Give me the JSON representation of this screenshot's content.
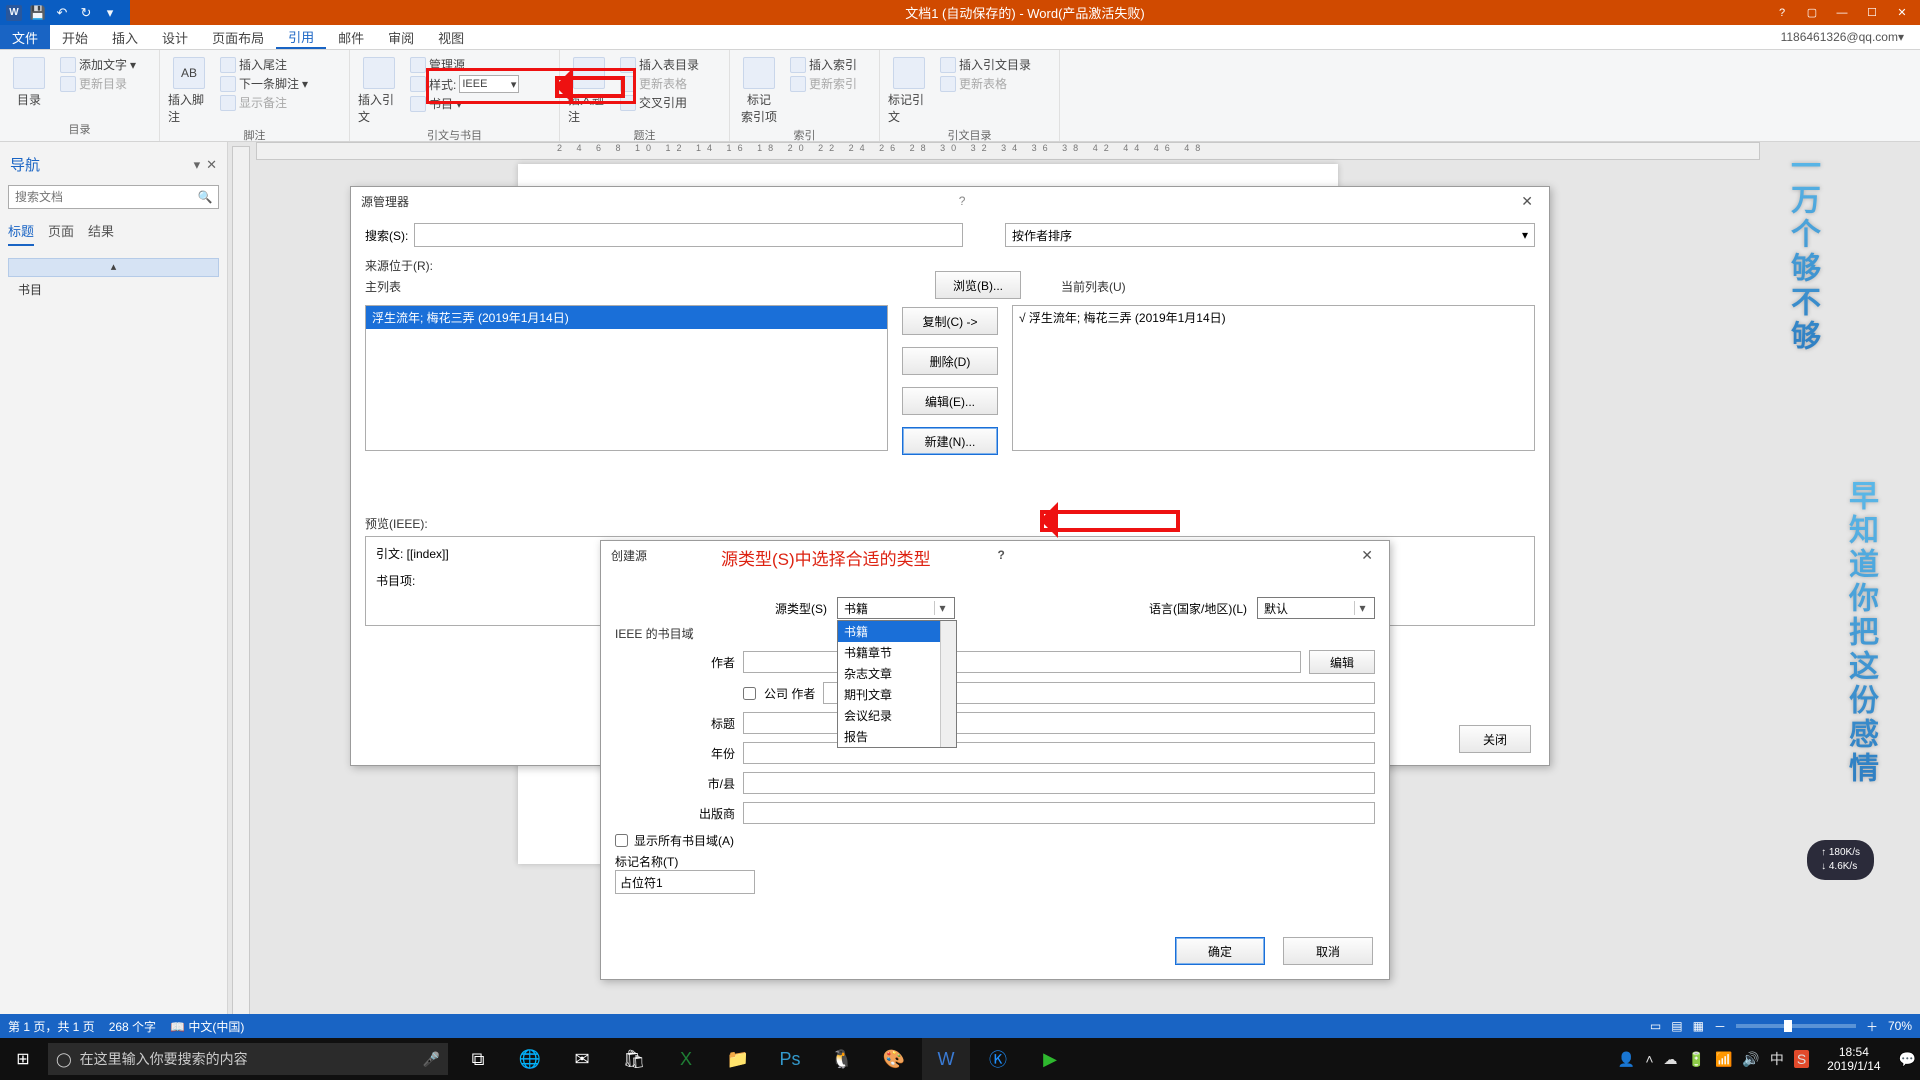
{
  "titlebar": {
    "title": "文档1 (自动保存的) - Word(产品激活失败)"
  },
  "account": "1186461326@qq.com",
  "ribbon_tabs": {
    "file": "文件",
    "home": "开始",
    "insert": "插入",
    "design": "设计",
    "layout": "页面布局",
    "references": "引用",
    "mailings": "邮件",
    "review": "审阅",
    "view": "视图"
  },
  "ribbon": {
    "toc": {
      "big": "目录",
      "add_text": "添加文字",
      "update": "更新目录",
      "group": "目录"
    },
    "footnotes": {
      "big_l1": "插入脚注",
      "ab": "AB",
      "next": "下一条脚注",
      "insert_end": "插入尾注",
      "show": "显示备注",
      "group": "脚注"
    },
    "citations": {
      "big_l1": "插入引文",
      "manage": "管理源",
      "style": "样式:",
      "style_val": "IEEE",
      "biblio": "书目",
      "group": "引文与书目"
    },
    "captions": {
      "big": "插入题注",
      "insert_tof": "插入表目录",
      "update_tof": "更新表格",
      "cross": "交叉引用",
      "group": "题注"
    },
    "index": {
      "big_l1": "标记",
      "big_l2": "索引项",
      "insert": "插入索引",
      "update": "更新索引",
      "group": "索引"
    },
    "toa": {
      "big": "标记引文",
      "insert": "插入引文目录",
      "update": "更新表格",
      "group": "引文目录"
    }
  },
  "nav": {
    "title": "导航",
    "search_ph": "搜索文档",
    "tabs": {
      "headings": "标题",
      "pages": "页面",
      "results": "结果"
    },
    "tree_item": "书目"
  },
  "ruler": "2  4  6  8  10  12  14  16  18  20  22  24  26  28  30  32  34  36  38        42  44  46  48",
  "wm1": "一万个够不够",
  "wm2": "早知道你把这份感情",
  "net": {
    "up": "↑ 180K/s",
    "down": "↓ 4.6K/s"
  },
  "srcmgr": {
    "title": "源管理器",
    "search": "搜索(S):",
    "sort": "按作者排序",
    "from": "来源位于(R):",
    "master": "主列表",
    "browse": "浏览(B)...",
    "current": "当前列表(U)",
    "copy": "复制(C) ->",
    "delete": "删除(D)",
    "edit": "编辑(E)...",
    "new": "新建(N)...",
    "entry": "浮生流年; 梅花三弄 (2019年1月14日)",
    "entry2": "√ 浮生流年; 梅花三弄 (2019年1月14日)",
    "preview": "预览(IEEE):",
    "citation": "引文:   [[index]]",
    "bibitem": "书目项:",
    "close": "关闭"
  },
  "create": {
    "title": "创建源",
    "hint": "源类型(S)中选择合适的类型",
    "src_type": "源类型(S)",
    "src_val": "书籍",
    "lang_lbl": "语言(国家/地区)(L)",
    "lang_val": "默认",
    "dd": [
      "书籍",
      "书籍章节",
      "杂志文章",
      "期刊文章",
      "会议纪录",
      "报告"
    ],
    "section": "IEEE 的书目域",
    "author": "作者",
    "corp": "公司 作者",
    "title_f": "标题",
    "year": "年份",
    "city": "市/县",
    "publisher": "出版商",
    "edit": "编辑",
    "showall": "显示所有书目域(A)",
    "tagname": "标记名称(T)",
    "tagval": "占位符1",
    "ok": "确定",
    "cancel": "取消"
  },
  "status": {
    "page": "第 1 页，共 1 页",
    "words": "268 个字",
    "lang": "中文(中国)",
    "zoom": "70%"
  },
  "taskbar": {
    "search_ph": "在这里输入你要搜索的内容",
    "time": "18:54",
    "date": "2019/1/14"
  }
}
